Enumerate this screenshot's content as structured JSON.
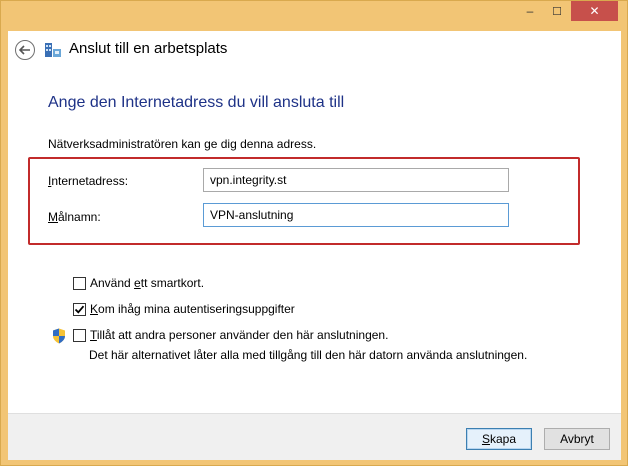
{
  "window": {
    "controls": {
      "minimize": "–",
      "maximize": "☐",
      "close": "✕"
    }
  },
  "nav": {
    "title": "Anslut till en arbetsplats",
    "back_icon": "back-arrow-icon",
    "app_icon": "network-connection-icon"
  },
  "main": {
    "heading": "Ange den Internetadress du vill ansluta till",
    "description": "Nätverksadministratören kan ge dig denna adress.",
    "fields": {
      "address": {
        "label_prefix": "I",
        "label_rest": "nternetadress:",
        "value": "vpn.integrity.st"
      },
      "destination": {
        "label_prefix": "M",
        "label_rest": "ålnamn:",
        "value": "VPN-anslutning"
      }
    },
    "options": {
      "smartcard": {
        "pre": "Använd ",
        "access": "e",
        "post": "tt smartkort.",
        "checked": false
      },
      "remember": {
        "pre": "",
        "access": "K",
        "post": "om ihåg mina autentiseringsuppgifter",
        "checked": true
      },
      "allow_others": {
        "pre": "",
        "access": "T",
        "post": "illåt att andra personer använder den här anslutningen.",
        "checked": false,
        "note": "Det här alternativet låter alla med tillgång till den här datorn använda anslutningen."
      }
    }
  },
  "footer": {
    "create": {
      "access": "S",
      "rest": "kapa"
    },
    "cancel": "Avbryt"
  },
  "colors": {
    "heading": "#1e3287",
    "highlight_border": "#c22b2b",
    "close_button": "#c7504b",
    "title_bar": "#f2c575"
  }
}
